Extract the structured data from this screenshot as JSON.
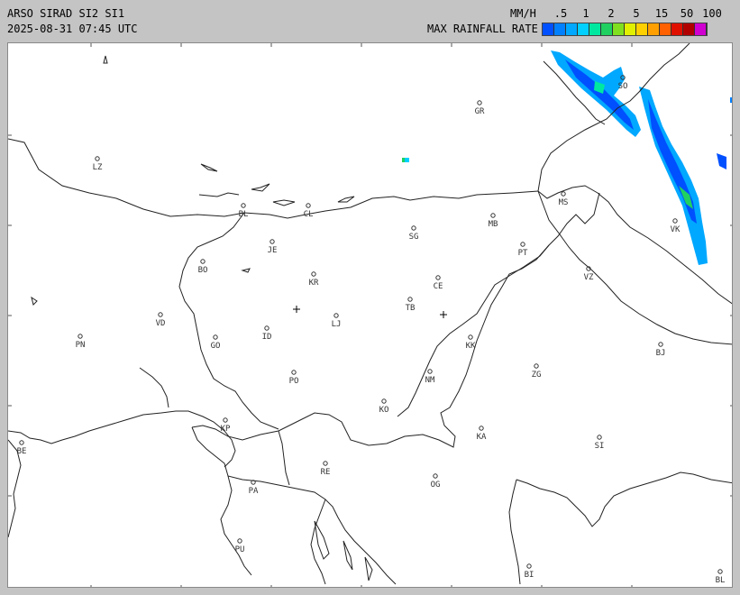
{
  "header": {
    "title": "ARSO SIRAD SI2 SI1",
    "timestamp": "2025-08-31 07:45 UTC",
    "units": "MM/H",
    "legend_label": "MAX RAINFALL RATE"
  },
  "legend": {
    "ticks": [
      ".5",
      "1",
      "2",
      "5",
      "15",
      "50",
      "100"
    ],
    "colors": [
      "#0050ff",
      "#0080ff",
      "#00a8ff",
      "#00d0ff",
      "#00e8a0",
      "#20d060",
      "#80e020",
      "#e0f000",
      "#ffd000",
      "#ffa000",
      "#ff6000",
      "#e01000",
      "#b00000",
      "#d000d0"
    ]
  },
  "map": {
    "places": [
      {
        "code": "SO"
      },
      {
        "code": "GR"
      },
      {
        "code": "LZ"
      },
      {
        "code": "BL"
      },
      {
        "code": "CL"
      },
      {
        "code": "MS"
      },
      {
        "code": "MB"
      },
      {
        "code": "SG"
      },
      {
        "code": "VK"
      },
      {
        "code": "JE"
      },
      {
        "code": "PT"
      },
      {
        "code": "BO"
      },
      {
        "code": "KR"
      },
      {
        "code": "CE"
      },
      {
        "code": "VZ"
      },
      {
        "code": "TB"
      },
      {
        "code": "VD"
      },
      {
        "code": "LJ"
      },
      {
        "code": "PN"
      },
      {
        "code": "ID"
      },
      {
        "code": "GO"
      },
      {
        "code": "KK"
      },
      {
        "code": "BJ"
      },
      {
        "code": "ZG"
      },
      {
        "code": "PO"
      },
      {
        "code": "NM"
      },
      {
        "code": "KO"
      },
      {
        "code": "KP"
      },
      {
        "code": "KA"
      },
      {
        "code": "SI"
      },
      {
        "code": "BE"
      },
      {
        "code": "RE"
      },
      {
        "code": "PA"
      },
      {
        "code": "OG"
      },
      {
        "code": "PU"
      },
      {
        "code": "BI"
      },
      {
        "code": "BL"
      }
    ]
  }
}
